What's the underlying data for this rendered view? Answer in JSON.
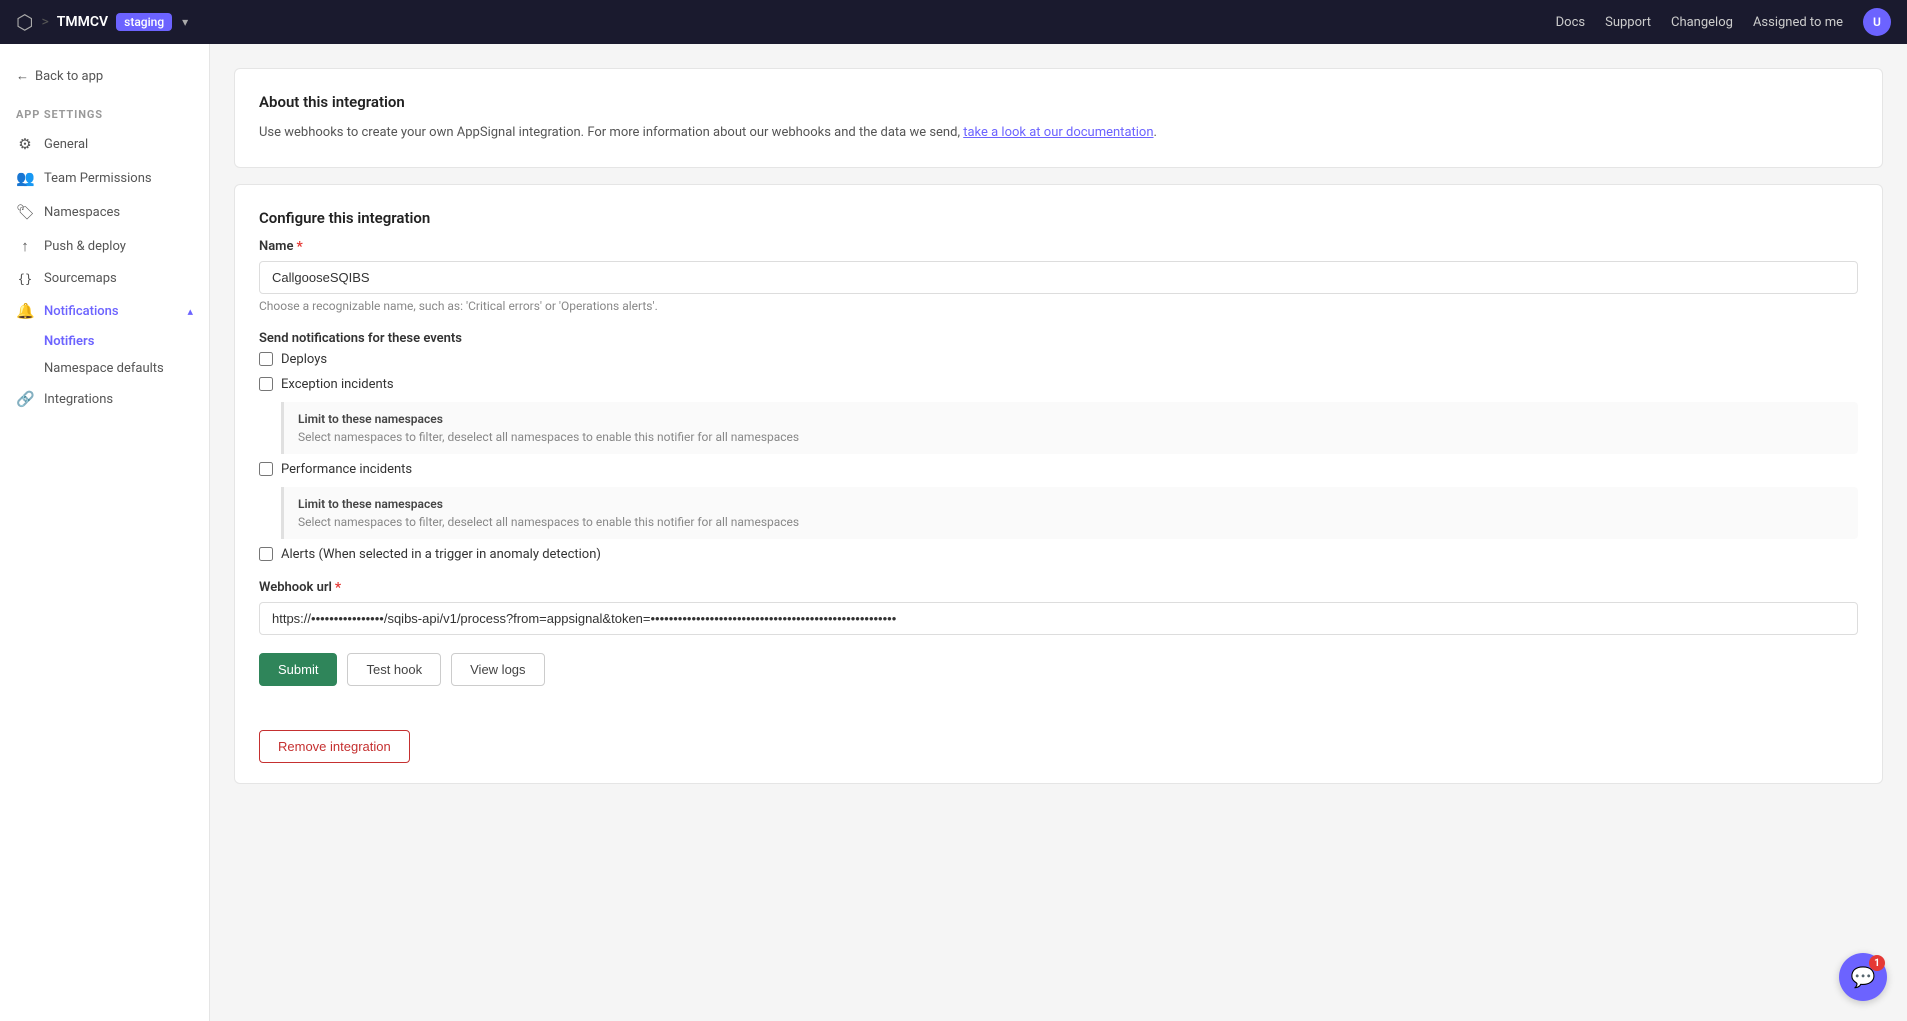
{
  "topnav": {
    "app_icon": "⬡",
    "app_name": "TMMCV",
    "divider": ">",
    "env_label": "staging",
    "links": [
      {
        "label": "Docs",
        "name": "docs-link"
      },
      {
        "label": "Support",
        "name": "support-link"
      },
      {
        "label": "Changelog",
        "name": "changelog-link"
      }
    ],
    "assigned_label": "Assigned to me",
    "avatar_initials": "U"
  },
  "sidebar": {
    "back_label": "Back to app",
    "section_label": "APP SETTINGS",
    "items": [
      {
        "label": "General",
        "icon": "⚙",
        "name": "general",
        "active": false
      },
      {
        "label": "Team Permissions",
        "icon": "👥",
        "name": "team-permissions",
        "active": false
      },
      {
        "label": "Namespaces",
        "icon": "🏷",
        "name": "namespaces",
        "active": false
      },
      {
        "label": "Push & deploy",
        "icon": "↑",
        "name": "push-deploy",
        "active": false
      },
      {
        "label": "Sourcemaps",
        "icon": "{}",
        "name": "sourcemaps",
        "active": false
      },
      {
        "label": "Notifications",
        "icon": "🔔",
        "name": "notifications",
        "active": true
      },
      {
        "label": "Integrations",
        "icon": "🔗",
        "name": "integrations",
        "active": false
      }
    ],
    "notifications_subitems": [
      {
        "label": "Notifiers",
        "name": "notifiers",
        "active": true
      },
      {
        "label": "Namespace defaults",
        "name": "namespace-defaults",
        "active": false
      }
    ]
  },
  "about_section": {
    "title": "About this integration",
    "description": "Use webhooks to create your own AppSignal integration. For more information about our webhooks and the data we send,",
    "link_text": "take a look at our documentation",
    "link_suffix": "."
  },
  "configure_section": {
    "title": "Configure this integration",
    "name_label": "Name",
    "name_required": true,
    "name_value": "CallgooseSQIBS",
    "name_hint": "Choose a recognizable name, such as: 'Critical errors' or 'Operations alerts'.",
    "events_label": "Send notifications for these events",
    "events": [
      {
        "label": "Deploys",
        "name": "deploys",
        "checked": false
      },
      {
        "label": "Exception incidents",
        "name": "exception-incidents",
        "checked": false
      }
    ],
    "namespace_limit_1_title": "Limit to these namespaces",
    "namespace_limit_1_desc": "Select namespaces to filter, deselect all namespaces to enable this notifier for all namespaces",
    "performance_label": "Performance incidents",
    "performance_checked": false,
    "namespace_limit_2_title": "Limit to these namespaces",
    "namespace_limit_2_desc": "Select namespaces to filter, deselect all namespaces to enable this notifier for all namespaces",
    "alerts_label": "Alerts (When selected in a trigger in anomaly detection)",
    "alerts_checked": false,
    "webhook_label": "Webhook url",
    "webhook_required": true,
    "webhook_value": "https://••••••••••••••••/sqibs-api/v1/process?from=appsignal&token=••••••••••••••••••••••••••••••••••••••••••••••••••••••",
    "buttons": {
      "submit": "Submit",
      "test_hook": "Test hook",
      "view_logs": "View logs"
    }
  },
  "remove_section": {
    "button_label": "Remove integration"
  },
  "chat": {
    "badge": "1"
  }
}
